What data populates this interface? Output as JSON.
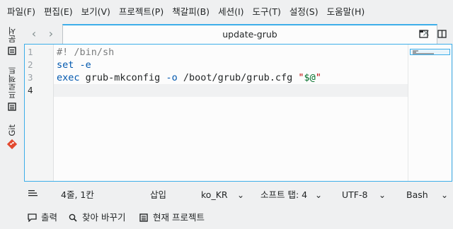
{
  "menubar": {
    "items": [
      "파일(F)",
      "편집(E)",
      "보기(V)",
      "프로젝트(P)",
      "책갈피(B)",
      "세션(I)",
      "도구(T)",
      "설정(S)",
      "도움말(H)"
    ]
  },
  "sidebar": {
    "tabs": [
      {
        "label": "문서",
        "icon": "document-icon"
      },
      {
        "label": "프로젝트",
        "icon": "project-icon"
      },
      {
        "label": "Git",
        "icon": "git-icon"
      }
    ]
  },
  "tabs": {
    "active_title": "update-grub",
    "close_glyph": "×"
  },
  "editor": {
    "line_numbers": [
      "1",
      "2",
      "3",
      "4"
    ],
    "current_line": 4,
    "lines": [
      [
        {
          "t": "#! /bin/sh",
          "c": "comment"
        }
      ],
      [
        {
          "t": "set",
          "c": "keyword"
        },
        {
          "t": " ",
          "c": ""
        },
        {
          "t": "-e",
          "c": "opt"
        }
      ],
      [
        {
          "t": "exec",
          "c": "keyword"
        },
        {
          "t": " grub-mkconfig ",
          "c": ""
        },
        {
          "t": "-o",
          "c": "opt"
        },
        {
          "t": " /boot/grub/grub.cfg ",
          "c": ""
        },
        {
          "t": "\"",
          "c": "string"
        },
        {
          "t": "$@",
          "c": "var"
        },
        {
          "t": "\"",
          "c": "string"
        }
      ],
      []
    ]
  },
  "statusbar": {
    "cursor": "4줄, 1칸",
    "mode": "삽입",
    "language": "ko_KR",
    "indent": "소프트 탭: 4",
    "encoding": "UTF-8",
    "syntax": "Bash"
  },
  "bottombar": {
    "output": "출력",
    "search_replace": "찾아 바꾸기",
    "current_project": "현재 프로젝트"
  },
  "colors": {
    "accent": "#3daee9",
    "git": "#e2492f"
  }
}
